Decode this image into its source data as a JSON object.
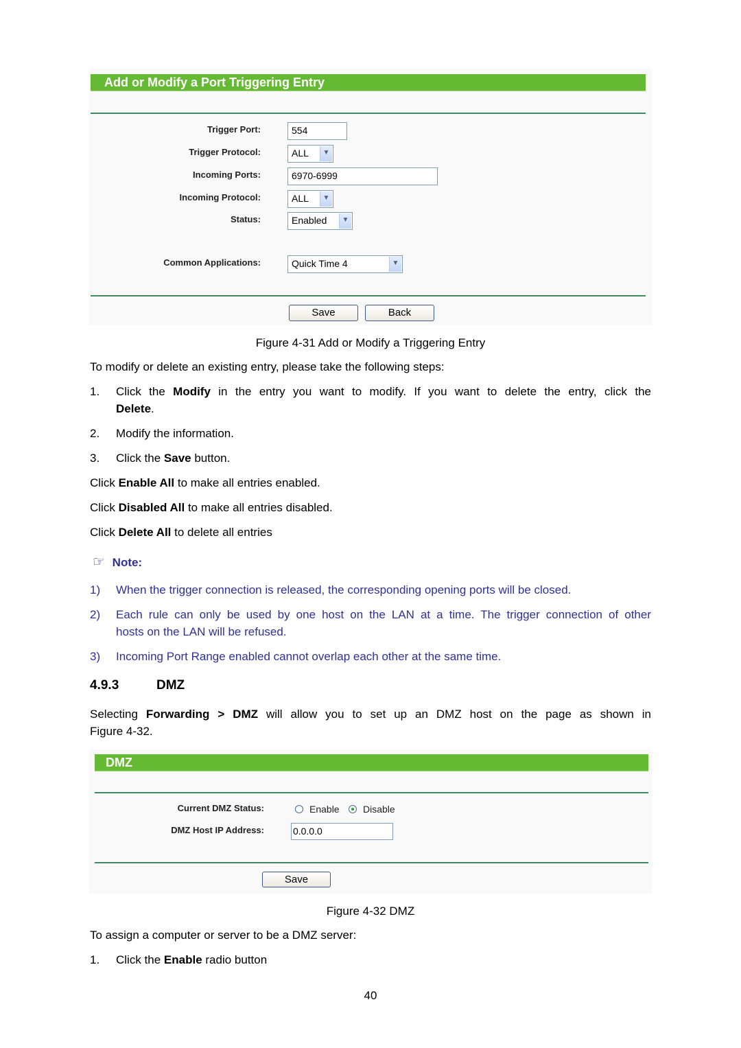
{
  "figure1": {
    "header": "Add or Modify a Port Triggering Entry",
    "fields": [
      {
        "label": "Trigger Port:",
        "type": "text",
        "value": "554"
      },
      {
        "label": "Trigger Protocol:",
        "type": "select",
        "value": "ALL"
      },
      {
        "label": "Incoming Ports:",
        "type": "text",
        "value": "6970-6999"
      },
      {
        "label": "Incoming Protocol:",
        "type": "select",
        "value": "ALL"
      },
      {
        "label": "Status:",
        "type": "select",
        "value": "Enabled"
      },
      {
        "label": "Common Applications:",
        "type": "select",
        "value": "Quick Time 4"
      }
    ],
    "buttons": {
      "save": "Save",
      "back": "Back"
    },
    "caption": "Figure 4-31 Add or Modify a Triggering Entry"
  },
  "steps_intro": "To modify or delete an existing entry, please take the following steps:",
  "steps": [
    {
      "num": "1.",
      "pre": "Click the ",
      "bold": "Modify",
      "post": " in the entry you want to modify. If you want to delete the entry, click the",
      "line2_bold": "Delete",
      "line2_post": "."
    },
    {
      "num": "2.",
      "text": "Modify the information."
    },
    {
      "num": "3.",
      "pre": "Click the ",
      "bold": "Save",
      "post": " button."
    }
  ],
  "clicks": [
    {
      "pre": "Click ",
      "bold": "Enable All",
      "post": " to make all entries enabled."
    },
    {
      "pre": "Click ",
      "bold": "Disabled All",
      "post": " to make all entries disabled."
    },
    {
      "pre": "Click ",
      "bold": "Delete All",
      "post": " to delete all entries"
    }
  ],
  "note": {
    "icon": "pointing-hand-icon",
    "icon_glyph": "☞",
    "title": "Note:",
    "items": [
      {
        "num": "1)",
        "text": "When the trigger connection is released, the corresponding opening ports will be closed."
      },
      {
        "num": "2)",
        "line1": "Each rule can only be used by one host on the LAN at a time. The trigger connection of other",
        "line2": "hosts on the LAN will be refused."
      },
      {
        "num": "3)",
        "text": "Incoming Port Range enabled cannot overlap each other at the same time."
      }
    ],
    "color": "#2e3192"
  },
  "section": {
    "number": "4.9.3",
    "title": "DMZ",
    "intro_pre": "Selecting ",
    "intro_bold1": "Forwarding",
    "intro_mid": " > ",
    "intro_bold2": "DMZ",
    "intro_post": " will allow you to set up an DMZ host on the page as shown in",
    "intro_line2": "Figure 4-32."
  },
  "figure2": {
    "header": "DMZ",
    "status_label": "Current DMZ Status:",
    "radio_enable": "Enable",
    "radio_disable": "Disable",
    "selected": "Disable",
    "ip_label": "DMZ Host IP Address:",
    "ip_value": "0.0.0.0",
    "save": "Save",
    "caption": "Figure 4-32 DMZ"
  },
  "assign_intro": "To assign a computer or server to be a DMZ server:",
  "assign_step": {
    "num": "1.",
    "pre": "Click the ",
    "bold": "Enable",
    "post": " radio button"
  },
  "page_number": "40",
  "colors": {
    "header_green": "#66b933",
    "divider": "#3f8a5e",
    "panel_bg": "#f9f9f9",
    "note_blue": "#2e3192"
  }
}
